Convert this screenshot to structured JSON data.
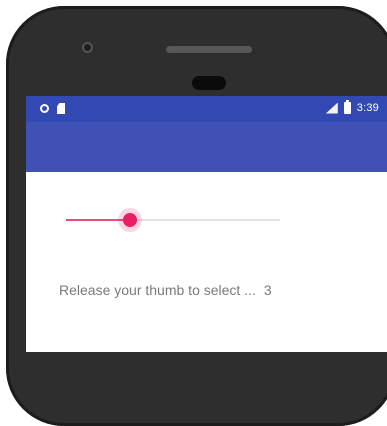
{
  "status_bar": {
    "time": "3:39",
    "left_icons": [
      "sync-icon",
      "sd-card-icon"
    ],
    "right_icons": [
      "signal-icon",
      "battery-icon"
    ]
  },
  "slider": {
    "value": 3,
    "fraction": 0.3
  },
  "message": {
    "text": "Release your thumb to select ...",
    "value": "3"
  },
  "colors": {
    "status_bar": "#3248b3",
    "app_bar": "#3f51b5",
    "accent": "#e91e63",
    "phone_body": "#2e2e2e"
  }
}
